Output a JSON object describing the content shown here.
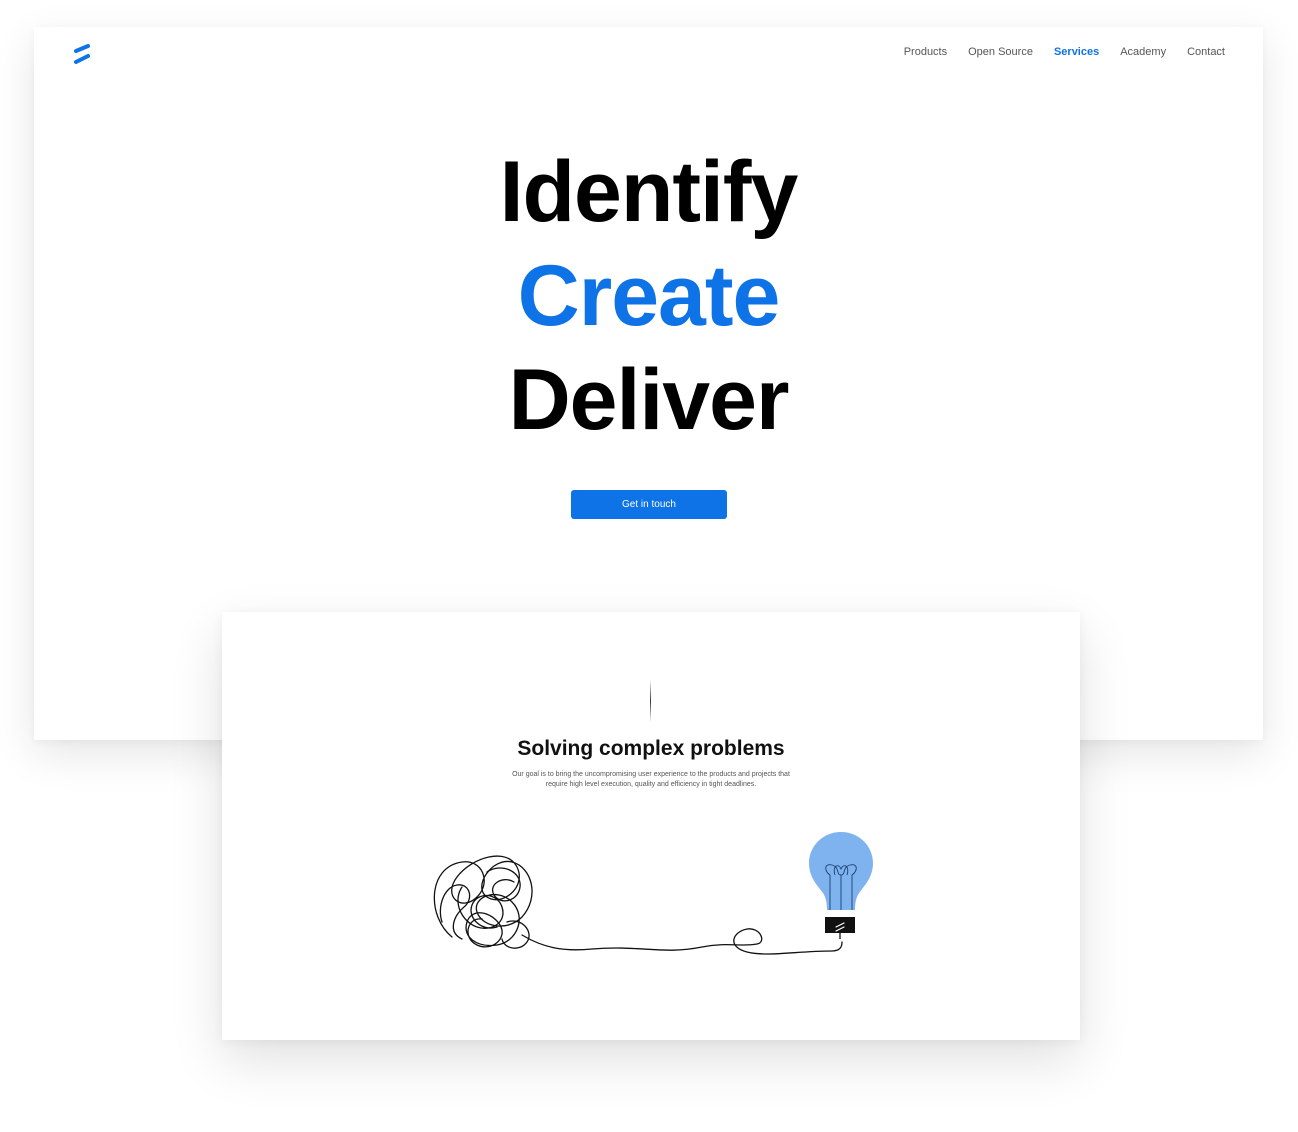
{
  "brand": {
    "logo_icon": "brand-logo-icon",
    "accent": "#0E73E6"
  },
  "nav": {
    "items": [
      {
        "label": "Products",
        "active": false
      },
      {
        "label": "Open Source",
        "active": false
      },
      {
        "label": "Services",
        "active": true
      },
      {
        "label": "Academy",
        "active": false
      },
      {
        "label": "Contact",
        "active": false
      }
    ]
  },
  "hero": {
    "line1": "Identify",
    "line2": "Create",
    "line3": "Deliver",
    "cta_label": "Get in touch"
  },
  "problems": {
    "title": "Solving complex problems",
    "description": "Our goal is to bring the uncompromising user experience to the products and projects that require high level execution, quality and efficiency in tight deadlines.",
    "illustration_icon": "tangled-line-to-lightbulb-illustration",
    "bulb_color": "#7FB3F0"
  }
}
